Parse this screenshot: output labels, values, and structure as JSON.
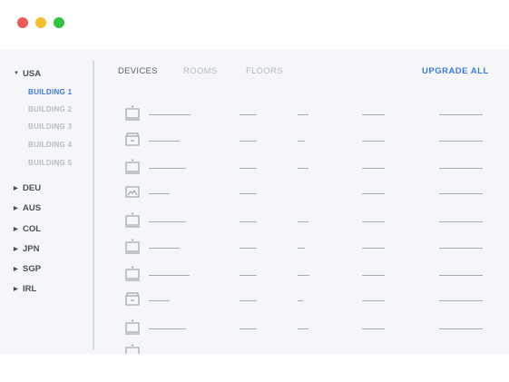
{
  "window": {
    "colors": {
      "close": "#ec5c57",
      "minimize": "#f5bd30",
      "zoom": "#32c444",
      "accent": "#3f7ad6"
    }
  },
  "sidebar": {
    "expanded_country": {
      "label": "USA",
      "buildings": [
        {
          "label": "BUILDING 1",
          "selected": true
        },
        {
          "label": "BUILDING 2",
          "selected": false
        },
        {
          "label": "BUILDING 3",
          "selected": false
        },
        {
          "label": "BUILDING 4",
          "selected": false
        },
        {
          "label": "BUILDING 5",
          "selected": false
        }
      ]
    },
    "collapsed_countries": [
      "DEU",
      "AUS",
      "COL",
      "JPN",
      "SGP",
      "IRL"
    ]
  },
  "main": {
    "tabs": [
      {
        "label": "DEVICES",
        "active": true
      },
      {
        "label": "ROOMS",
        "active": false
      },
      {
        "label": "FLOORS",
        "active": false
      }
    ],
    "upgrade_all_label": "UPGRADE ALL",
    "device_rows": [
      {
        "icon": "laptop-icon"
      },
      {
        "icon": "printer-icon"
      },
      {
        "icon": "laptop-icon"
      },
      {
        "icon": "display-icon"
      },
      {
        "icon": "laptop-icon"
      },
      {
        "icon": "laptop-icon"
      },
      {
        "icon": "laptop-icon"
      },
      {
        "icon": "printer-icon"
      },
      {
        "icon": "laptop-icon"
      },
      {
        "icon": "laptop-icon"
      }
    ]
  }
}
